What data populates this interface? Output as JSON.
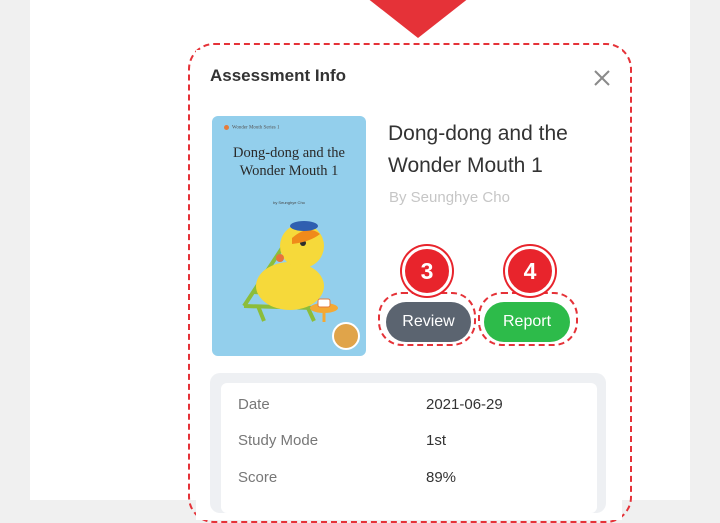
{
  "modal": {
    "title": "Assessment Info"
  },
  "book": {
    "title": "Dong-dong and the Wonder Mouth 1",
    "author": "By Seunghye Cho",
    "cover": {
      "series": "Wonder Mouth Series 1",
      "title": "Dong-dong and the Wonder Mouth 1",
      "author": "by Seunghye Cho"
    }
  },
  "actions": {
    "review_label": "Review",
    "report_label": "Report"
  },
  "annotations": {
    "review_step": "3",
    "report_step": "4"
  },
  "info": {
    "rows": [
      {
        "label": "Date",
        "value": "2021-06-29"
      },
      {
        "label": "Study Mode",
        "value": "1st"
      },
      {
        "label": "Score",
        "value": "89%"
      }
    ]
  },
  "colors": {
    "highlight": "#e53238",
    "review_button": "#5b6470",
    "report_button": "#2dbb4a",
    "cover_background": "#93cfec"
  },
  "icons": {
    "close": "close-icon",
    "pointer": "down-arrow-pointer"
  }
}
